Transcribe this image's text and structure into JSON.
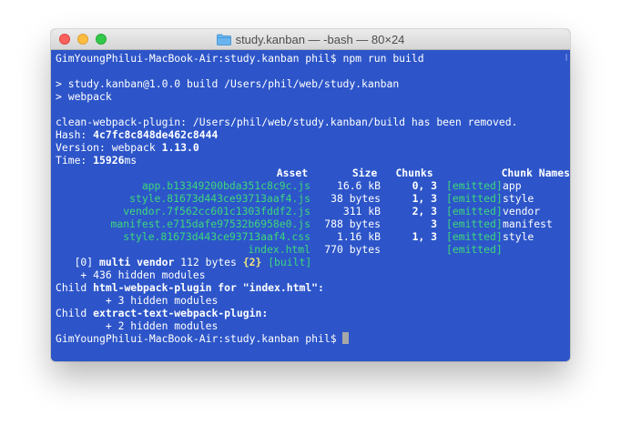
{
  "window": {
    "title": "study.kanban — -bash — 80×24",
    "folder_icon": "folder-icon"
  },
  "terminal": {
    "prompt1": "GimYoungPhilui-MacBook-Air:study.kanban phil$ npm run build",
    "npm_line1": "> study.kanban@1.0.0 build /Users/phil/web/study.kanban",
    "npm_line2": "> webpack",
    "clean_line": "clean-webpack-plugin: /Users/phil/web/study.kanban/build has been removed.",
    "hash_label": "Hash: ",
    "hash_value": "4c7fc8c848de462c8444",
    "version_label": "Version: webpack ",
    "version_value": "1.13.0",
    "time_label": "Time: ",
    "time_value": "15926",
    "time_unit": "ms",
    "headers": {
      "asset": "Asset",
      "size": "Size",
      "chunks": "Chunks",
      "chunk_names": "Chunk Names"
    },
    "rows": [
      {
        "asset": "app.b13349200bda351c8c9c.js",
        "size": "16.6 kB",
        "chunks": "0, 3",
        "emitted": "[emitted]",
        "name": "app"
      },
      {
        "asset": "style.81673d443ce93713aaf4.js",
        "size": "38 bytes",
        "chunks": "1, 3",
        "emitted": "[emitted]",
        "name": "style"
      },
      {
        "asset": "vendor.7f562cc601c1303fddf2.js",
        "size": "311 kB",
        "chunks": "2, 3",
        "emitted": "[emitted]",
        "name": "vendor"
      },
      {
        "asset": "manifest.e715dafe97532b6958e0.js",
        "size": "788 bytes",
        "chunks": "3",
        "emitted": "[emitted]",
        "name": "manifest"
      },
      {
        "asset": "style.81673d443ce93713aaf4.css",
        "size": "1.16 kB",
        "chunks": "1, 3",
        "emitted": "[emitted]",
        "name": "style"
      },
      {
        "asset": "index.html",
        "size": "770 bytes",
        "chunks": "",
        "emitted": "[emitted]",
        "name": ""
      }
    ],
    "chunk_prefix": "   [0] ",
    "chunk_bold": "multi vendor",
    "chunk_size": " 112 bytes ",
    "chunk_id": "{2}",
    "chunk_built": "[built]",
    "hidden1": "    + 436 hidden modules",
    "child1_label": "Child ",
    "child1_bold": "html-webpack-plugin for \"index.html\":",
    "hidden2": "        + 3 hidden modules",
    "child2_label": "Child ",
    "child2_bold": "extract-text-webpack-plugin:",
    "hidden3": "        + 2 hidden modules",
    "prompt2": "GimYoungPhilui-MacBook-Air:study.kanban phil$ "
  },
  "colors": {
    "terminal_bg": "#2d55c9",
    "emitted_green": "#3ed77a",
    "chunk_id_yellow": "#f1e27b"
  }
}
